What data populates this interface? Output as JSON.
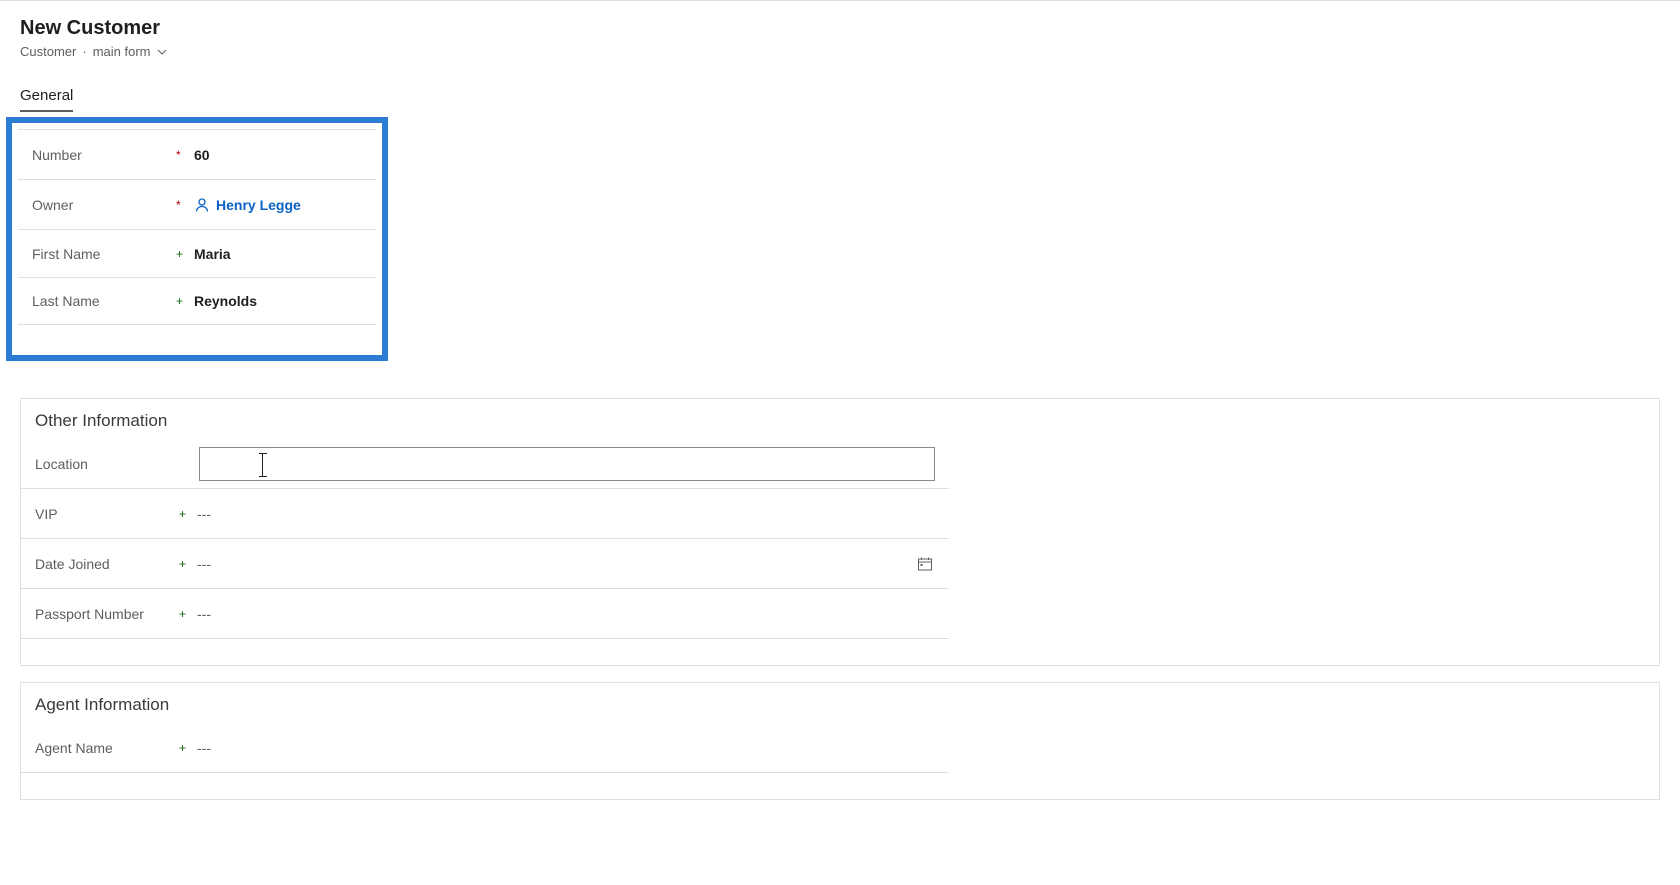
{
  "header": {
    "title": "New Customer",
    "breadcrumb_entity": "Customer",
    "breadcrumb_form": "main form"
  },
  "tabs": {
    "general": "General"
  },
  "general_section": {
    "fields": {
      "number": {
        "label": "Number",
        "value": "60",
        "required": true
      },
      "owner": {
        "label": "Owner",
        "value": "Henry Legge",
        "required": true
      },
      "first_name": {
        "label": "First Name",
        "value": "Maria",
        "required": false
      },
      "last_name": {
        "label": "Last Name",
        "value": "Reynolds",
        "required": false
      }
    }
  },
  "other_section": {
    "title": "Other Information",
    "fields": {
      "location": {
        "label": "Location",
        "value": ""
      },
      "vip": {
        "label": "VIP",
        "value": "---"
      },
      "date_joined": {
        "label": "Date Joined",
        "value": "---"
      },
      "passport_number": {
        "label": "Passport Number",
        "value": "---"
      }
    }
  },
  "agent_section": {
    "title": "Agent Information",
    "fields": {
      "agent_name": {
        "label": "Agent Name",
        "value": "---"
      }
    }
  }
}
